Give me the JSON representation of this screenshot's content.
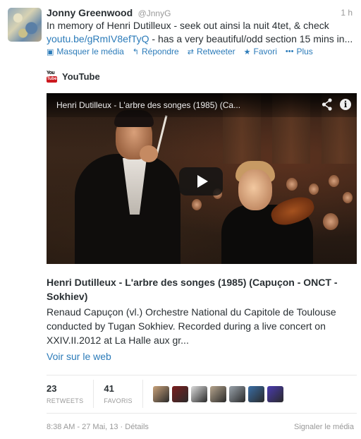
{
  "tweet": {
    "name": "Jonny Greenwood",
    "handle": "@JnnyG",
    "time": "1 h",
    "text_part1": "In memory of Henri Dutilleux - seek out ainsi la nuit 4tet, & check",
    "link": "youtu.be/gRmIV8efTyQ",
    "text_part2": " - has a very beautiful/odd section 15 mins in..."
  },
  "actions": [
    {
      "icon": "media-icon",
      "glyph": "▣",
      "label": "Masquer le média"
    },
    {
      "icon": "reply-icon",
      "glyph": "↰",
      "label": "Répondre"
    },
    {
      "icon": "retweet-icon",
      "glyph": "⇄",
      "label": "Retweeter"
    },
    {
      "icon": "star-icon",
      "glyph": "★",
      "label": "Favori"
    },
    {
      "icon": "more-icon",
      "glyph": "•••",
      "label": "Plus"
    }
  ],
  "card": {
    "provider": "YouTube",
    "provider_logo_top": "You",
    "provider_logo_box": "Tube",
    "video_title": "Henri Dutilleux - L'arbre des songes (1985) (Ca...",
    "title": "Henri Dutilleux - L'arbre des songes (1985) (Capuçon - ONCT - Sokhiev)",
    "description": "Renaud Capuçon (vl.) Orchestre National du Capitole de Toulouse conducted by Tugan Sokhiev. Recorded during a live concert on XXIV.II.2012 at La Halle aux gr...",
    "web_link": "Voir sur le web",
    "info_glyph": "i"
  },
  "stats": {
    "retweets": "23",
    "retweets_label": "RETWEETS",
    "favorites": "41",
    "favorites_label": "FAVORIS"
  },
  "favoriter_colors": [
    "#c9a27a",
    "#7a1e1e",
    "#dcdcdc",
    "#b6a58e",
    "#9aa3ab",
    "#3a6ea5",
    "#4a3bb0"
  ],
  "footer": {
    "timestamp": "8:38 AM - 27 Mai, 13",
    "separator": " · ",
    "details": "Détails",
    "report": "Signaler le média"
  }
}
